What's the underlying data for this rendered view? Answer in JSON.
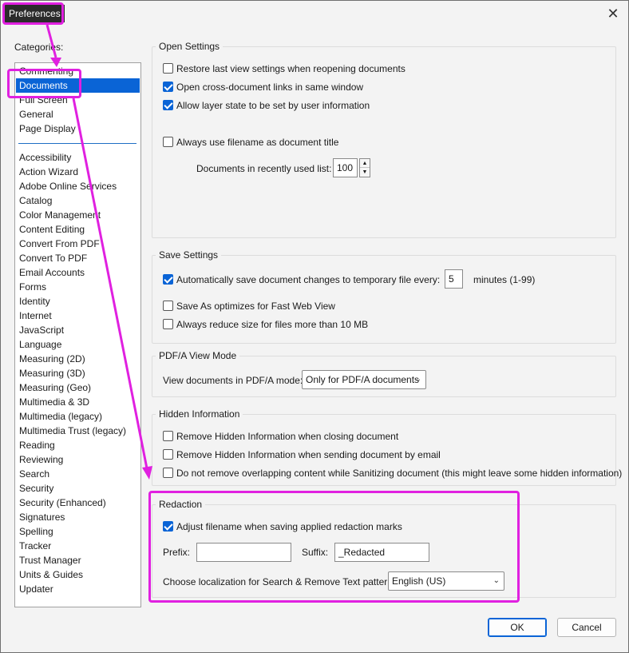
{
  "window": {
    "title": "Preferences",
    "close_label": "✕"
  },
  "categories": {
    "label": "Categories:",
    "top_items": [
      "Commenting",
      "Documents",
      "Full Screen",
      "General",
      "Page Display"
    ],
    "bottom_items": [
      "Accessibility",
      "Action Wizard",
      "Adobe Online Services",
      "Catalog",
      "Color Management",
      "Content Editing",
      "Convert From PDF",
      "Convert To PDF",
      "Email Accounts",
      "Forms",
      "Identity",
      "Internet",
      "JavaScript",
      "Language",
      "Measuring (2D)",
      "Measuring (3D)",
      "Measuring (Geo)",
      "Multimedia & 3D",
      "Multimedia (legacy)",
      "Multimedia Trust (legacy)",
      "Reading",
      "Reviewing",
      "Search",
      "Security",
      "Security (Enhanced)",
      "Signatures",
      "Spelling",
      "Tracker",
      "Trust Manager",
      "Units & Guides",
      "Updater"
    ],
    "selected": "Documents"
  },
  "open_settings": {
    "title": "Open Settings",
    "restore_last_view": {
      "label": "Restore last view settings when reopening documents",
      "checked": false
    },
    "open_cross_doc": {
      "label": "Open cross-document links in same window",
      "checked": true
    },
    "allow_layer_state": {
      "label": "Allow layer state to be set by user information",
      "checked": true
    },
    "always_use_filename": {
      "label": "Always use filename as document title",
      "checked": false
    },
    "recent_list_label": "Documents in recently used list:",
    "recent_list_value": "100"
  },
  "save_settings": {
    "title": "Save Settings",
    "auto_save": {
      "label": "Automatically save document changes to temporary file every:",
      "checked": true
    },
    "auto_save_minutes": "5",
    "minutes_label": "minutes (1-99)",
    "save_as_optimizes": {
      "label": "Save As optimizes for Fast Web View",
      "checked": false
    },
    "always_reduce": {
      "label": "Always reduce size for files more than 10 MB",
      "checked": false
    }
  },
  "pdfa": {
    "title": "PDF/A View Mode",
    "mode_label": "View documents in PDF/A mode:",
    "mode_value": "Only for PDF/A documents"
  },
  "hidden_info": {
    "title": "Hidden Information",
    "remove_closing": {
      "label": "Remove Hidden Information when closing document",
      "checked": false
    },
    "remove_email": {
      "label": "Remove Hidden Information when sending document by email",
      "checked": false
    },
    "no_remove_overlap": {
      "label": "Do not remove overlapping content while Sanitizing document (this might leave some hidden information)",
      "checked": false
    }
  },
  "redaction": {
    "title": "Redaction",
    "adjust_filename": {
      "label": "Adjust filename when saving applied redaction marks",
      "checked": true
    },
    "prefix_label": "Prefix:",
    "prefix_value": "",
    "suffix_label": "Suffix:",
    "suffix_value": "_Redacted",
    "localization_label": "Choose localization for Search & Remove Text patterns:",
    "localization_value": "English (US)"
  },
  "buttons": {
    "ok": "OK",
    "cancel": "Cancel"
  },
  "colors": {
    "accent": "#0a64d6",
    "annotation": "#e020e0",
    "title_bg": "#2b2b2b"
  }
}
